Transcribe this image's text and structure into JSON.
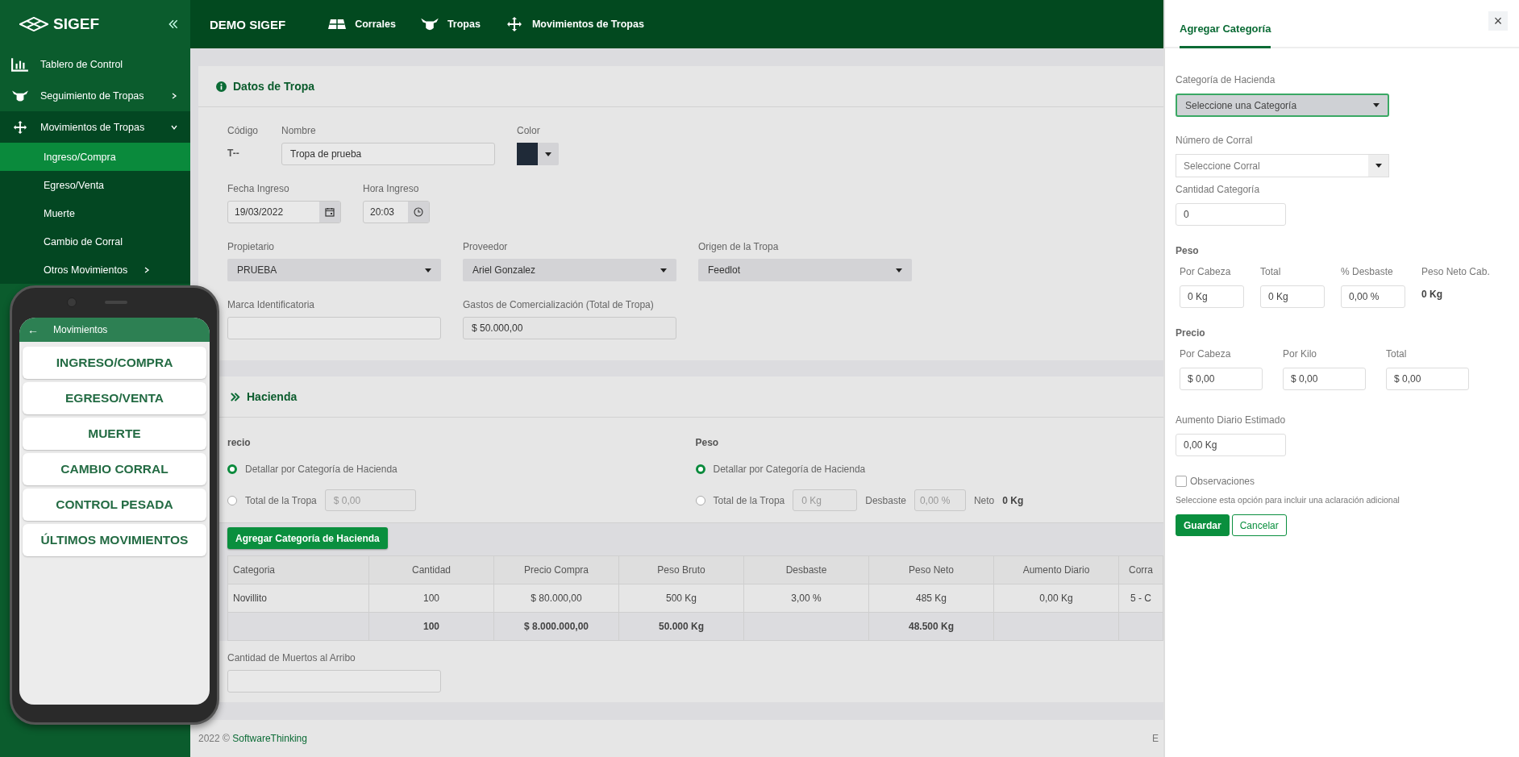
{
  "sidebar": {
    "logo": "SIGEF",
    "items": [
      {
        "label": "Tablero de Control"
      },
      {
        "label": "Seguimiento de Tropas",
        "expanded": false
      },
      {
        "label": "Movimientos de Tropas",
        "expanded": true,
        "children": [
          {
            "label": "Ingreso/Compra",
            "selected": true
          },
          {
            "label": "Egreso/Venta",
            "selected": false
          },
          {
            "label": "Muerte",
            "selected": false
          },
          {
            "label": "Cambio de Corral",
            "selected": false
          },
          {
            "label": "Otros Movimientos",
            "selected": false,
            "expanded": false
          }
        ]
      }
    ]
  },
  "header": {
    "title": "DEMO SIGEF",
    "nav": [
      {
        "label": "Corrales"
      },
      {
        "label": "Tropas"
      },
      {
        "label": "Movimientos de Tropas"
      }
    ]
  },
  "datos": {
    "title": "Datos de Tropa",
    "codigo": {
      "label": "Código",
      "value": "T--"
    },
    "nombre": {
      "label": "Nombre",
      "value": "Tropa de prueba"
    },
    "color": {
      "label": "Color",
      "color": "#1f2a38"
    },
    "fecha": {
      "label": "Fecha Ingreso",
      "value": "19/03/2022"
    },
    "hora": {
      "label": "Hora Ingreso",
      "value": "20:03"
    },
    "selects": [
      {
        "label": "Propietario",
        "value": "PRUEBA"
      },
      {
        "label": "Proveedor",
        "value": "Ariel Gonzalez"
      },
      {
        "label": "Origen de la Tropa",
        "value": "Feedlot"
      }
    ],
    "marca": {
      "label": "Marca Identificatoria"
    },
    "gastos": {
      "label": "Gastos de Comercialización (Total de Tropa)",
      "value": "$ 50.000,00"
    }
  },
  "hacienda": {
    "title": "Hacienda",
    "precio": {
      "title": "recio",
      "options": [
        {
          "label": "Detallar por Categoría de Hacienda",
          "selected": true
        },
        {
          "label": "Total de la Tropa",
          "selected": false,
          "placeholder": "$ 0,00"
        }
      ]
    },
    "peso": {
      "title": "Peso",
      "options": [
        {
          "label": "Detallar por Categoría de Hacienda",
          "selected": true
        },
        {
          "label": "Total de la Tropa",
          "selected": false,
          "placeholder": "0 Kg"
        }
      ],
      "desbaste_label": "Desbaste",
      "desbaste_placeholder": "0,00 %",
      "neto_label": "Neto",
      "neto_value": "0 Kg"
    },
    "add_button": "Agregar Categoría de Hacienda",
    "table": {
      "columns": [
        "Categoria",
        "Cantidad",
        "Precio Compra",
        "Peso Bruto",
        "Desbaste",
        "Peso Neto",
        "Aumento Diario",
        "Corra"
      ],
      "rows": [
        [
          "Novillito",
          "100",
          "$ 80.000,00",
          "500 Kg",
          "3,00 %",
          "485 Kg",
          "0,00 Kg",
          "5 - C"
        ]
      ],
      "totals": {
        "cantidad": "100",
        "precio_compra": "$ 8.000.000,00",
        "peso_bruto": "50.000 Kg",
        "peso_neto": "48.500 Kg"
      }
    },
    "muertos": {
      "label": "Cantidad de Muertos al Arribo"
    }
  },
  "footer": {
    "year": "2022 ©",
    "brand": "SoftwareThinking",
    "right": "E"
  },
  "phone": {
    "back": "←",
    "title": "Movimientos",
    "buttons": [
      "INGRESO/COMPRA",
      "EGRESO/VENTA",
      "MUERTE",
      "CAMBIO CORRAL",
      "CONTROL PESADA",
      "ÚLTIMOS MOVIMIENTOS"
    ]
  },
  "panel": {
    "tab": "Agregar Categoría",
    "close": "×",
    "categoria": {
      "label": "Categoría de Hacienda",
      "value": "Seleccione una Categoría"
    },
    "corral": {
      "label": "Número de Corral",
      "placeholder": "Seleccione Corral"
    },
    "cantidad": {
      "label": "Cantidad Categoría",
      "value": "0"
    },
    "peso": {
      "title": "Peso",
      "fields": [
        {
          "label": "Por Cabeza",
          "value": "0 Kg"
        },
        {
          "label": "Total",
          "value": "0 Kg"
        },
        {
          "label": "% Desbaste",
          "value": "0,00 %"
        }
      ],
      "neto": {
        "label": "Peso Neto Cab.",
        "value": "0 Kg"
      }
    },
    "precio": {
      "title": "Precio",
      "fields": [
        {
          "label": "Por Cabeza",
          "value": "$ 0,00"
        },
        {
          "label": "Por Kilo",
          "value": "$ 0,00"
        },
        {
          "label": "Total",
          "value": "$ 0,00"
        }
      ]
    },
    "aumento": {
      "label": "Aumento Diario Estimado",
      "value": "0,00 Kg"
    },
    "observaciones": {
      "label": "Observaciones",
      "checked": false
    },
    "help": "Seleccione esta opción para incluir una aclaración adicional",
    "buttons": [
      {
        "label": "Guardar",
        "kind": "primary"
      },
      {
        "label": "Cancelar",
        "kind": "secondary"
      }
    ]
  }
}
